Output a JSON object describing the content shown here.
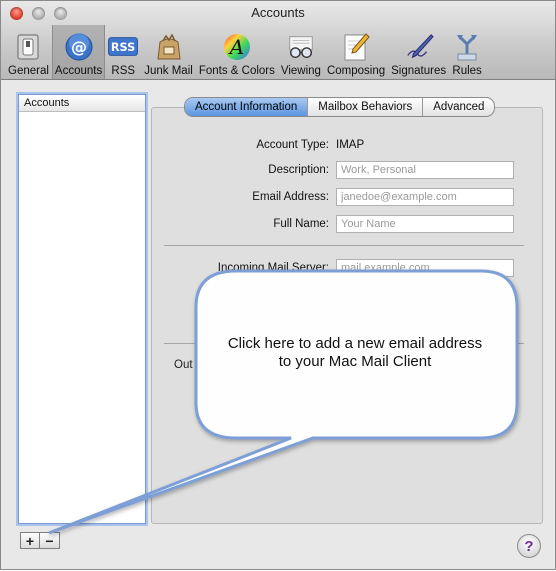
{
  "window": {
    "title": "Accounts"
  },
  "toolbar": {
    "items": [
      {
        "label": "General",
        "icon": "general-switch-icon"
      },
      {
        "label": "Accounts",
        "icon": "at-sign-icon",
        "selected": true
      },
      {
        "label": "RSS",
        "icon": "rss-icon"
      },
      {
        "label": "Junk Mail",
        "icon": "junk-mail-bag-icon"
      },
      {
        "label": "Fonts & Colors",
        "icon": "fonts-colors-icon"
      },
      {
        "label": "Viewing",
        "icon": "viewing-glasses-icon"
      },
      {
        "label": "Composing",
        "icon": "composing-pencil-icon"
      },
      {
        "label": "Signatures",
        "icon": "signature-pen-icon"
      },
      {
        "label": "Rules",
        "icon": "rules-arrows-icon"
      }
    ],
    "rss_badge": "RSS"
  },
  "accounts_list": {
    "header": "Accounts"
  },
  "tabs": [
    {
      "label": "Account Information",
      "active": true
    },
    {
      "label": "Mailbox Behaviors"
    },
    {
      "label": "Advanced"
    }
  ],
  "form": {
    "account_type_label": "Account Type:",
    "account_type_value": "IMAP",
    "description_label": "Description:",
    "description_placeholder": "Work, Personal",
    "email_label": "Email Address:",
    "email_placeholder": "janedoe@example.com",
    "fullname_label": "Full Name:",
    "fullname_placeholder": "Your Name",
    "incoming_label": "Incoming Mail Server:",
    "incoming_placeholder": "mail.example.com",
    "outgoing_partial": "Out"
  },
  "buttons": {
    "add": "+",
    "remove": "−",
    "help": "?"
  },
  "callout": {
    "text_line1": "Click here to add a new email address",
    "text_line2": "to your Mac Mail Client"
  },
  "colors": {
    "selection_blue": "#5c95e0",
    "help_purple": "#6a2da0"
  }
}
